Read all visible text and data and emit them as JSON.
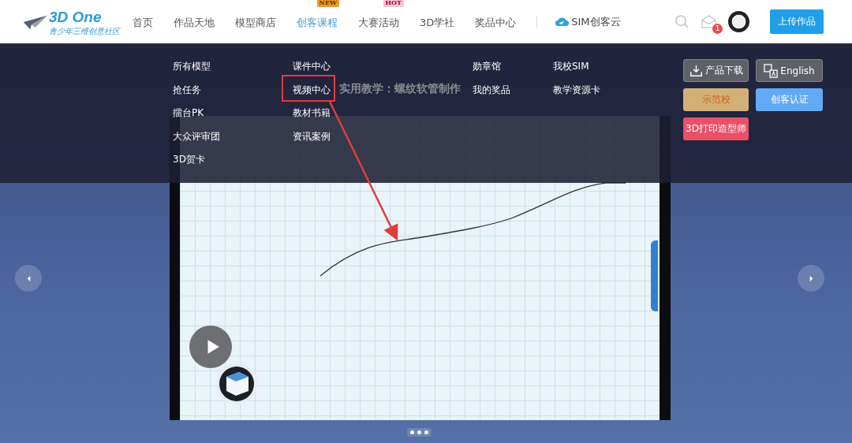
{
  "logo": {
    "title": "3D One",
    "subtitle": "青少年三维创意社区"
  },
  "nav": [
    {
      "label": "首页",
      "selected": false
    },
    {
      "label": "作品天地",
      "selected": false
    },
    {
      "label": "模型商店",
      "selected": false
    },
    {
      "label": "创客课程",
      "selected": true,
      "badge": "NEW"
    },
    {
      "label": "大赛活动",
      "selected": false,
      "badge": "HOT"
    },
    {
      "label": "3D学社",
      "selected": false
    },
    {
      "label": "奖品中心",
      "selected": false
    }
  ],
  "cloud_link": "SIM创客云",
  "notification_count": "1",
  "upload_button": "上传作品",
  "menu_columns": [
    [
      "所有模型",
      "抢任务",
      "擂台PK",
      "大众评审团",
      "3D贺卡"
    ],
    [
      "课件中心",
      "视频中心",
      "教材书籍",
      "资讯案例"
    ],
    [
      "勋章馆",
      "我的奖品"
    ],
    [
      "我校SIM",
      "教学资源卡"
    ]
  ],
  "side_buttons": [
    {
      "label": "产品下载",
      "kind": "dark"
    },
    {
      "label": "English",
      "kind": "dark"
    },
    {
      "label": "示范校",
      "kind": "gold"
    },
    {
      "label": "创客认证",
      "kind": "blue"
    },
    {
      "label": "3D打印造型师",
      "kind": "red"
    }
  ],
  "video": {
    "title": "实用教学：螺纹软管制作"
  }
}
